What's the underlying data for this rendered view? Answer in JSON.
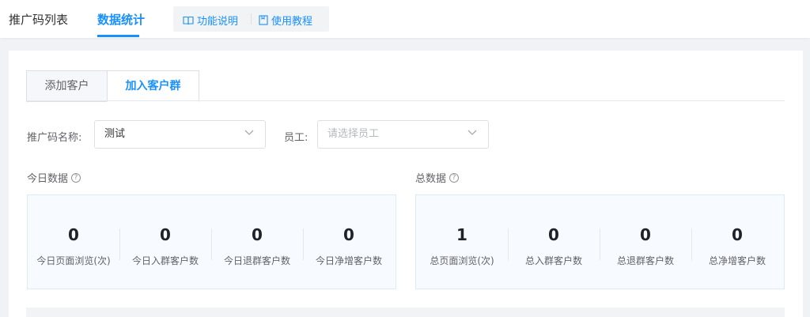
{
  "top_nav": {
    "tabs": [
      {
        "label": "推广码列表",
        "active": false
      },
      {
        "label": "数据统计",
        "active": true
      }
    ],
    "help_links": [
      {
        "label": "功能说明",
        "icon": "book-icon"
      },
      {
        "label": "使用教程",
        "icon": "document-icon"
      }
    ]
  },
  "sub_tabs": [
    {
      "label": "添加客户",
      "active": false
    },
    {
      "label": "加入客户群",
      "active": true
    }
  ],
  "filters": {
    "promo_code_label": "推广码名称:",
    "promo_code_value": "测试",
    "staff_label": "员工:",
    "staff_placeholder": "请选择员工"
  },
  "today": {
    "title": "今日数据",
    "stats": [
      {
        "value": "0",
        "label": "今日页面浏览(次)"
      },
      {
        "value": "0",
        "label": "今日入群客户数"
      },
      {
        "value": "0",
        "label": "今日退群客户数"
      },
      {
        "value": "0",
        "label": "今日净增客户数"
      }
    ]
  },
  "total": {
    "title": "总数据",
    "stats": [
      {
        "value": "1",
        "label": "总页面浏览(次)"
      },
      {
        "value": "0",
        "label": "总入群客户数"
      },
      {
        "value": "0",
        "label": "总退群客户数"
      },
      {
        "value": "0",
        "label": "总净增客户数"
      }
    ]
  },
  "colors": {
    "accent": "#1890ff",
    "panel_bg": "#f7fbff",
    "panel_border": "#d9ecf7"
  }
}
